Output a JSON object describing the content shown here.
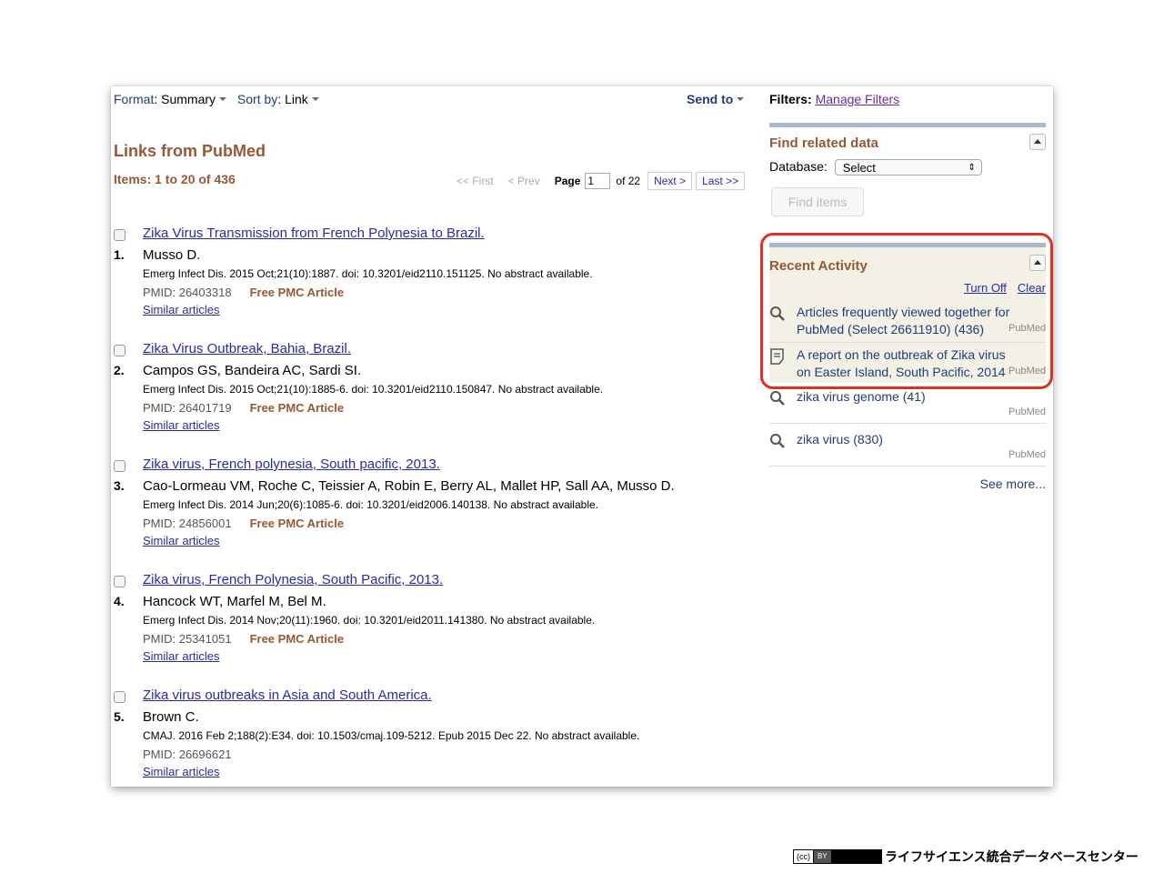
{
  "toolbar": {
    "format_label": "Format",
    "format_value": "Summary",
    "sort_label": "Sort by",
    "sort_value": "Link",
    "send_to": "Send to"
  },
  "heading": "Links from PubMed",
  "items_count": "Items: 1 to 20 of 436",
  "pager": {
    "first": "<< First",
    "prev": "< Prev",
    "page_label": "Page",
    "page_value": "1",
    "of": "of 22",
    "next": "Next >",
    "last": "Last >>"
  },
  "results": [
    {
      "num": "1.",
      "title": "Zika Virus Transmission from French Polynesia to Brazil.",
      "authors": "Musso D.",
      "citation": "Emerg Infect Dis. 2015 Oct;21(10):1887. doi: 10.3201/eid2110.151125. No abstract available.",
      "pmid": "PMID: 26403318",
      "free": "Free PMC Article",
      "similar": "Similar articles"
    },
    {
      "num": "2.",
      "title": "Zika Virus Outbreak, Bahia, Brazil.",
      "authors": "Campos GS, Bandeira AC, Sardi SI.",
      "citation": "Emerg Infect Dis. 2015 Oct;21(10):1885-6. doi: 10.3201/eid2110.150847. No abstract available.",
      "pmid": "PMID: 26401719",
      "free": "Free PMC Article",
      "similar": "Similar articles"
    },
    {
      "num": "3.",
      "title": "Zika virus, French polynesia, South pacific, 2013.",
      "authors": "Cao-Lormeau VM, Roche C, Teissier A, Robin E, Berry AL, Mallet HP, Sall AA, Musso D.",
      "citation": "Emerg Infect Dis. 2014 Jun;20(6):1085-6. doi: 10.3201/eid2006.140138. No abstract available.",
      "pmid": "PMID: 24856001",
      "free": "Free PMC Article",
      "similar": "Similar articles"
    },
    {
      "num": "4.",
      "title": "Zika virus, French Polynesia, South Pacific, 2013.",
      "authors": "Hancock WT, Marfel M, Bel M.",
      "citation": "Emerg Infect Dis. 2014 Nov;20(11):1960. doi: 10.3201/eid2011.141380. No abstract available.",
      "pmid": "PMID: 25341051",
      "free": "Free PMC Article",
      "similar": "Similar articles"
    },
    {
      "num": "5.",
      "title": "Zika virus outbreaks in Asia and South America.",
      "authors": "Brown C.",
      "citation": "CMAJ. 2016 Feb 2;188(2):E34. doi: 10.1503/cmaj.109-5212. Epub 2015 Dec 22. No abstract available.",
      "pmid": "PMID: 26696621",
      "free": "",
      "similar": "Similar articles"
    }
  ],
  "sidebar": {
    "filters_label": "Filters:",
    "manage_filters": "Manage Filters",
    "find_related": "Find related data",
    "database_label": "Database:",
    "database_value": "Select",
    "find_items": "Find items",
    "recent_activity": "Recent Activity",
    "turn_off": "Turn Off",
    "clear": "Clear",
    "activity": [
      {
        "icon": "search-icon",
        "text": "Articles frequently viewed together for PubMed (Select 26611910) (436)",
        "source": "PubMed"
      },
      {
        "icon": "document-icon",
        "text": "A report on the outbreak of Zika virus on Easter Island, South Pacific, 2014",
        "source": "PubMed"
      },
      {
        "icon": "search-icon",
        "text": "zika virus genome (41)",
        "source": "PubMed"
      },
      {
        "icon": "search-icon",
        "text": "zika virus (830)",
        "source": "PubMed"
      }
    ],
    "see_more": "See more..."
  },
  "footer": {
    "license_cc": "(cc)",
    "license_by": "BY",
    "organization": "ライフサイエンス統合データベースセンター"
  },
  "colors": {
    "heading": "#985735",
    "link": "#2a2aa8",
    "highlight": "#e0301e"
  }
}
